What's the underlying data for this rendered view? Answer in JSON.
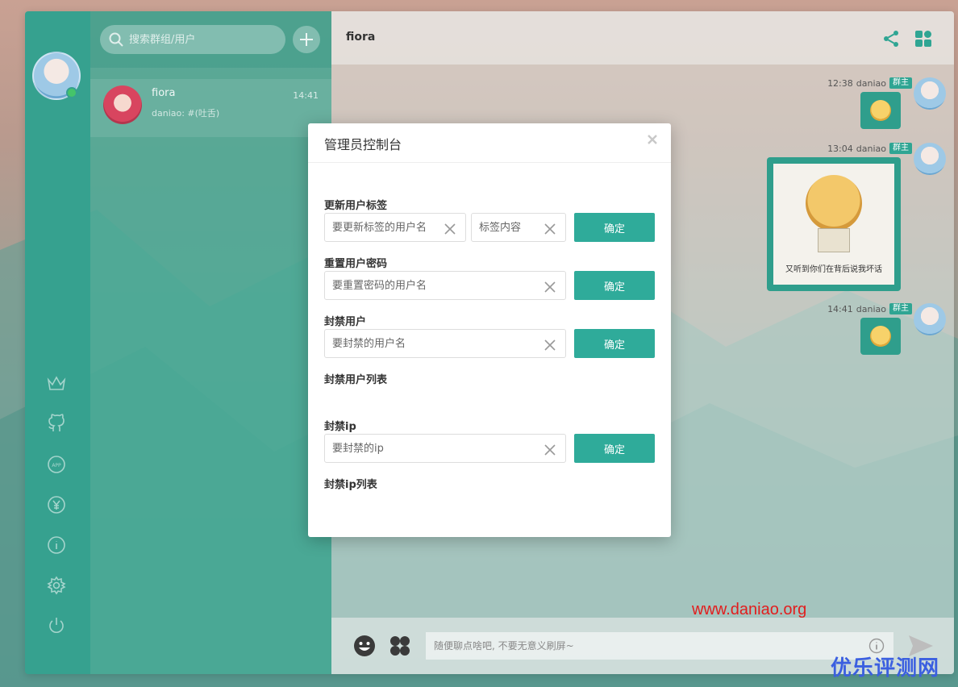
{
  "sidebar": {
    "icons": [
      "crown-icon",
      "github-icon",
      "app-icon",
      "yen-icon",
      "info-icon",
      "gear-icon",
      "power-icon"
    ]
  },
  "contacts": {
    "search_placeholder": "搜索群组/用户",
    "items": [
      {
        "name": "fiora",
        "time": "14:41",
        "last_message": "daniao: #(吐舌)"
      }
    ]
  },
  "chat": {
    "title": "fiora",
    "messages": [
      {
        "time": "12:38",
        "user": "daniao",
        "badge": "群主",
        "content": "emoji"
      },
      {
        "time": "13:04",
        "user": "daniao",
        "badge": "群主",
        "content": "sticker",
        "sticker_text": "又听到你们在背后说我坏话"
      },
      {
        "time": "14:41",
        "user": "daniao",
        "badge": "群主",
        "content": "emoji"
      }
    ],
    "input_placeholder": "随便聊点啥吧, 不要无意义刷屏~"
  },
  "modal": {
    "title": "管理员控制台",
    "update_tag": {
      "label": "更新用户标签",
      "username_placeholder": "要更新标签的用户名",
      "tag_placeholder": "标签内容",
      "button": "确定"
    },
    "reset_password": {
      "label": "重置用户密码",
      "placeholder": "要重置密码的用户名",
      "button": "确定"
    },
    "ban_user": {
      "label": "封禁用户",
      "placeholder": "要封禁的用户名",
      "button": "确定"
    },
    "banned_users_label": "封禁用户列表",
    "ban_ip": {
      "label": "封禁ip",
      "placeholder": "要封禁的ip",
      "button": "确定"
    },
    "banned_ips_label": "封禁ip列表"
  },
  "watermarks": {
    "site": "www.daniao.org",
    "brand": "优乐评测网"
  },
  "colors": {
    "accent": "#2fab9a",
    "nav": "#36a18f",
    "watermark_red": "#e21d1d",
    "watermark_blue": "#3b5fe0"
  }
}
